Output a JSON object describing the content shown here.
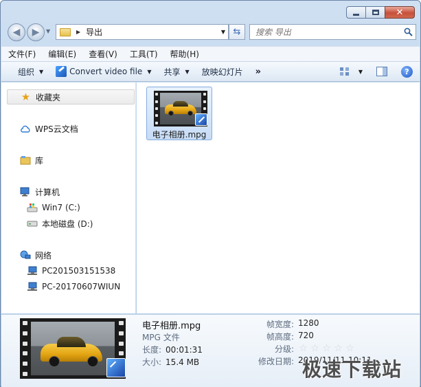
{
  "window": {
    "controls": {
      "close_label": "✕"
    }
  },
  "nav": {
    "address_path": "导出",
    "search_placeholder": "搜索 导出"
  },
  "menubar": [
    "文件(F)",
    "编辑(E)",
    "查看(V)",
    "工具(T)",
    "帮助(H)"
  ],
  "toolbar": {
    "organize": "组织",
    "convert": "Convert video file",
    "share": "共享",
    "slideshow": "放映幻灯片",
    "more": "»",
    "help": "?"
  },
  "sidebar": {
    "favorites": "收藏夹",
    "wps": "WPS云文档",
    "library": "库",
    "computer": "计算机",
    "drive_c": "Win7 (C:)",
    "drive_d": "本地磁盘 (D:)",
    "network": "网络",
    "pc1": "PC201503151538",
    "pc2": "PC-20170607WIUN"
  },
  "files": [
    {
      "name": "电子相册.mpg"
    }
  ],
  "details": {
    "name": "电子相册.mpg",
    "type": "MPG 文件",
    "length_label": "长度:",
    "length": "00:01:31",
    "size_label": "大小:",
    "size": "15.4 MB",
    "width_label": "帧宽度:",
    "width": "1280",
    "height_label": "帧高度:",
    "height": "720",
    "rating_label": "分级:",
    "rating": 0,
    "modified_label": "修改日期:",
    "modified": "2019/11/11 10:11"
  },
  "watermark": "极速下载站",
  "colors": {
    "title_grad": "#b9d1ea",
    "selection": "#c7dcf6",
    "help": "#1d58c4"
  }
}
